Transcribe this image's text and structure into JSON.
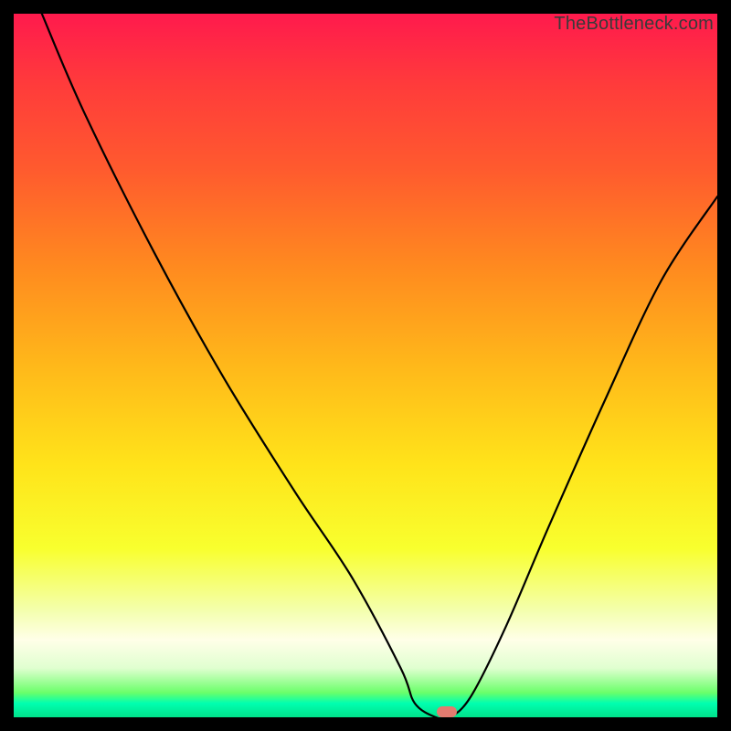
{
  "watermark": "TheBottleneck.com",
  "marker": {
    "x_frac": 0.615,
    "y_frac": 0.992,
    "color": "#e27b6f"
  },
  "chart_data": {
    "type": "line",
    "title": "",
    "xlabel": "",
    "ylabel": "",
    "xlim": [
      0,
      100
    ],
    "ylim": [
      0,
      100
    ],
    "series": [
      {
        "name": "bottleneck-curve",
        "x": [
          4,
          10,
          20,
          30,
          40,
          48,
          55,
          57,
          60,
          62,
          65,
          70,
          76,
          84,
          92,
          100
        ],
        "y": [
          100,
          86,
          66,
          48,
          32,
          20,
          7,
          2,
          0,
          0,
          3,
          13,
          27,
          45,
          62,
          74
        ]
      }
    ],
    "annotations": [
      {
        "type": "marker",
        "x": 61.5,
        "y": 0,
        "label": "optimal-point"
      }
    ],
    "background_gradient": {
      "stops": [
        {
          "pos": 0,
          "color": "#ff1a4d"
        },
        {
          "pos": 50,
          "color": "#ffe31a"
        },
        {
          "pos": 100,
          "color": "#00e28a"
        }
      ]
    }
  }
}
